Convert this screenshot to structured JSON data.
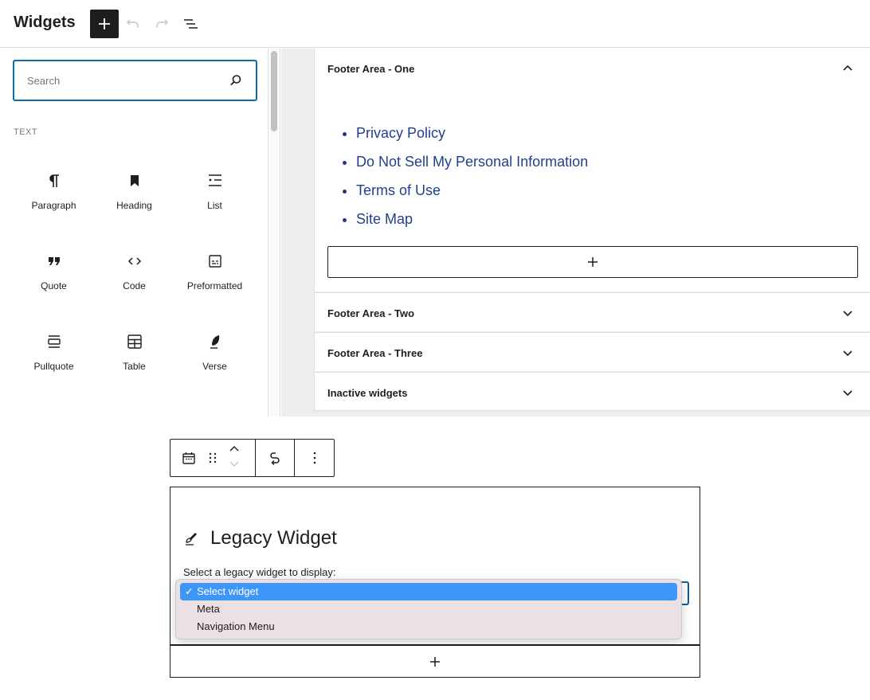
{
  "header": {
    "title": "Widgets",
    "add_block_icon": "plus-icon",
    "undo_icon": "undo-icon",
    "redo_icon": "redo-icon",
    "list_view_icon": "list-view-icon"
  },
  "inserter": {
    "search": {
      "placeholder": "Search",
      "value": "",
      "icon": "search-icon"
    },
    "category": "TEXT",
    "blocks": [
      {
        "label": "Paragraph",
        "icon": "paragraph-icon"
      },
      {
        "label": "Heading",
        "icon": "heading-bookmark-icon"
      },
      {
        "label": "List",
        "icon": "list-icon"
      },
      {
        "label": "Quote",
        "icon": "quote-icon"
      },
      {
        "label": "Code",
        "icon": "code-icon"
      },
      {
        "label": "Preformatted",
        "icon": "preformatted-icon"
      },
      {
        "label": "Pullquote",
        "icon": "pullquote-icon"
      },
      {
        "label": "Table",
        "icon": "table-icon"
      },
      {
        "label": "Verse",
        "icon": "feather-icon"
      }
    ]
  },
  "widget_areas": [
    {
      "title": "Footer Area - One",
      "expanded": true,
      "links": [
        "Privacy Policy",
        "Do Not Sell My Personal Information",
        "Terms of Use",
        "Site Map"
      ]
    },
    {
      "title": "Footer Area - Two",
      "expanded": false
    },
    {
      "title": "Footer Area - Three",
      "expanded": false
    },
    {
      "title": "Inactive widgets",
      "expanded": false
    }
  ],
  "block_toolbar": {
    "block_icon": "calendar-icon",
    "drag_icon": "drag-handle-icon",
    "move_up_icon": "chevron-up-icon",
    "move_down_icon": "chevron-down-icon",
    "transform_icon": "transform-icon",
    "options_icon": "more-vertical-icon"
  },
  "legacy_widget": {
    "title": "Legacy Widget",
    "label": "Select a legacy widget to display:",
    "selected": "Select widget",
    "options": [
      "Select widget",
      "Meta",
      "Navigation Menu"
    ]
  },
  "colors": {
    "accent": "#0a6da4",
    "link": "#22418b",
    "dropdown_selected": "#3e97f8",
    "dropdown_bg": "#ebe1e4"
  }
}
